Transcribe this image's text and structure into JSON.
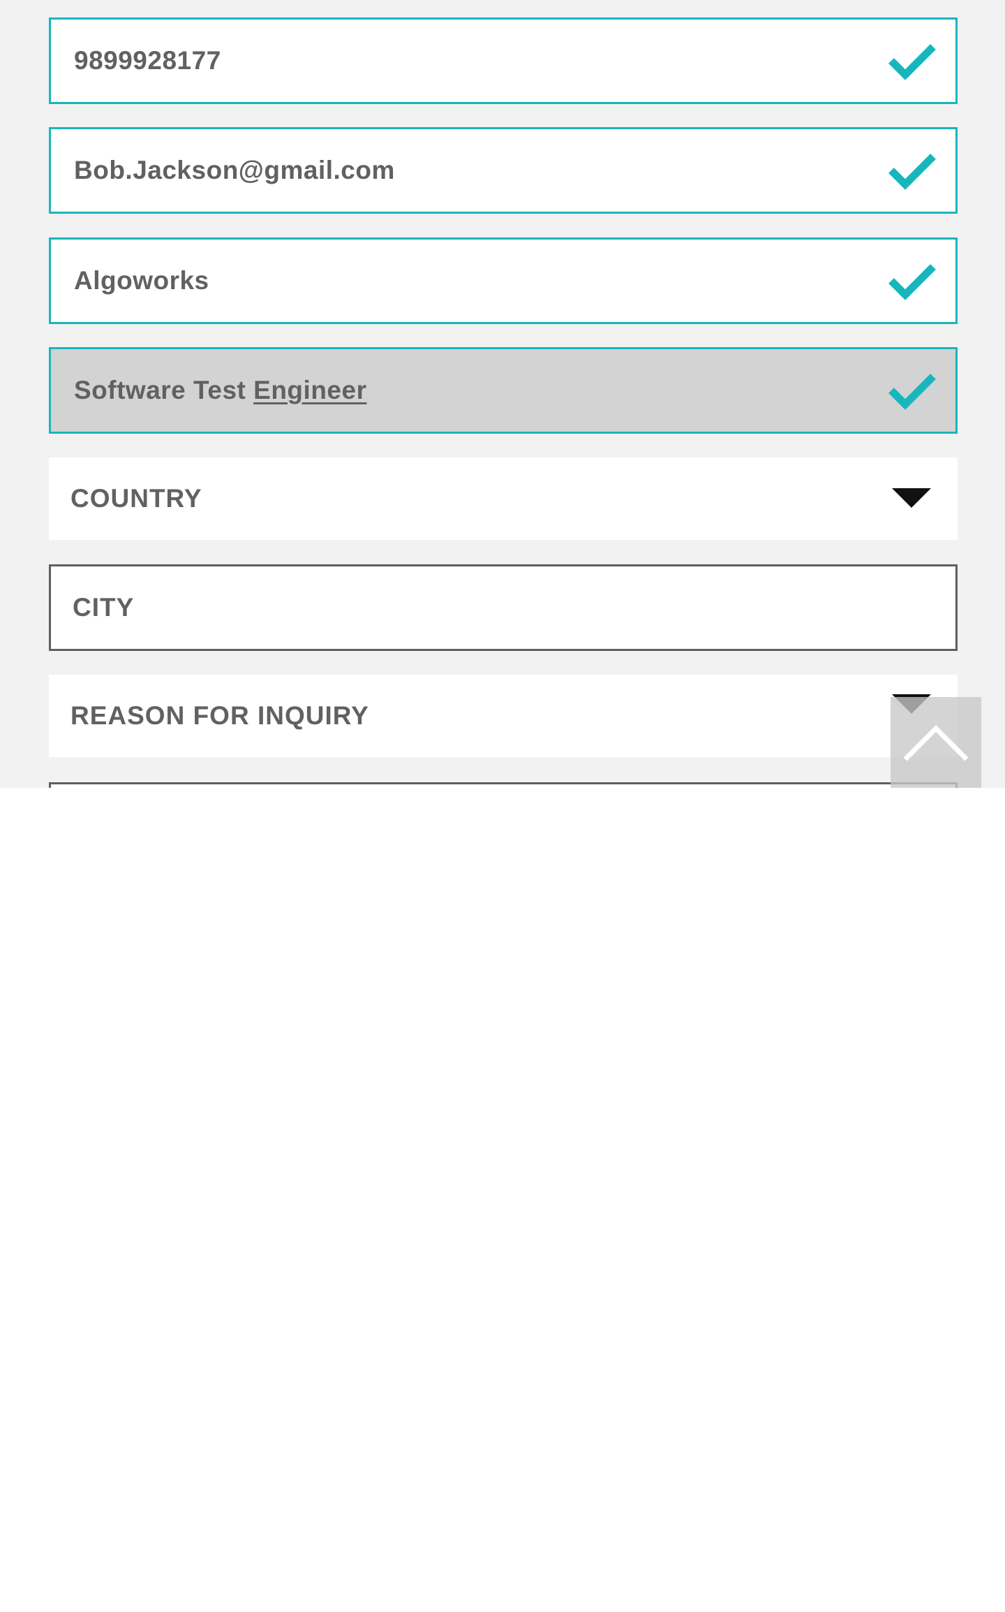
{
  "form": {
    "phone": {
      "value": "9899928177",
      "status": "valid"
    },
    "email": {
      "value": "Bob.Jackson@gmail.com",
      "status": "valid"
    },
    "company": {
      "value": "Algoworks",
      "status": "valid"
    },
    "job_title": {
      "value_prefix": "Software Test ",
      "value_underlined": "Engineer",
      "status": "valid"
    },
    "country": {
      "placeholder": "COUNTRY",
      "icon": "caret-down-icon"
    },
    "city": {
      "placeholder": "CITY"
    },
    "reason": {
      "placeholder": "REASON FOR INQUIRY",
      "icon": "caret-down-icon"
    }
  },
  "scroll_top": {
    "icon": "chevron-up-icon"
  },
  "colors": {
    "accent": "#17b6bd",
    "text": "#616161",
    "page_bg": "#f2f2f2",
    "focused_bg": "#d3d3d3",
    "empty_border": "#5f5f5f"
  }
}
